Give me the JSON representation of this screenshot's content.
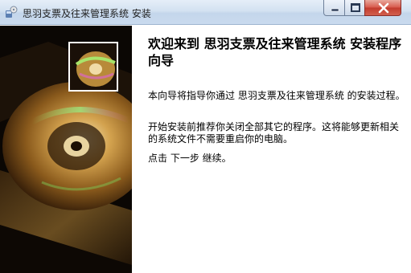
{
  "window": {
    "title": "思羽支票及往来管理系统 安装",
    "controls": {
      "minimize": "minimize",
      "maximize": "maximize",
      "close": "close"
    }
  },
  "icons": {
    "app": "installer-app-icon",
    "minimize": "minimize-icon",
    "maximize": "maximize-icon",
    "close": "close-icon"
  },
  "wizard": {
    "heading": "欢迎来到 思羽支票及往来管理系统 安装程序向导",
    "paragraphs": [
      "本向导将指导你通过 思羽支票及往来管理系统 的安装过程。",
      "开始安装前推荐你关闭全部其它的程序。这将能够更新相关的系统文件不需要重启你的电脑。",
      "点击 下一步 继续。"
    ]
  },
  "colors": {
    "titlebar": "#d3e1f1",
    "close_button": "#c23b2d",
    "sidebar_bg": "#0a0604"
  }
}
